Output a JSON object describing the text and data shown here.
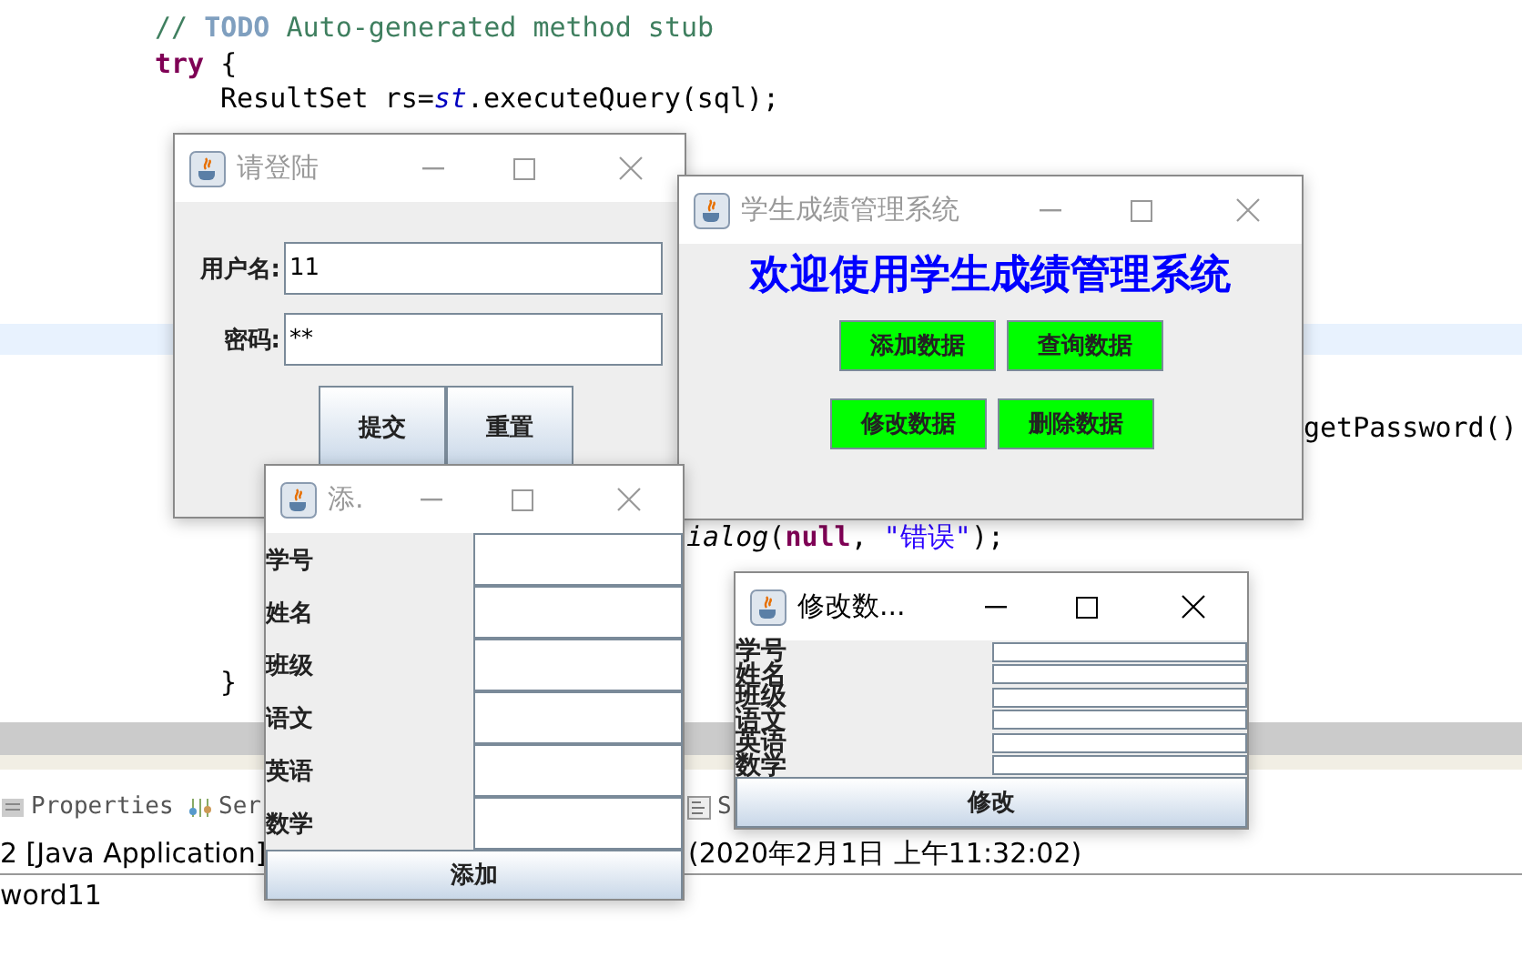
{
  "editor": {
    "code_lines": [
      [
        {
          "kind": "comment",
          "text": "// "
        },
        {
          "kind": "todo",
          "text": "TODO"
        },
        {
          "kind": "comment",
          "text": " Auto-generated method stub"
        }
      ],
      [
        {
          "kind": "keyword",
          "text": "try"
        },
        {
          "kind": "plain",
          "text": " {"
        }
      ],
      [
        {
          "kind": "plain",
          "text": "ResultSet rs="
        },
        {
          "kind": "field",
          "text": "st"
        },
        {
          "kind": "plain",
          "text": ".executeQuery(sql);"
        }
      ],
      [
        {
          "kind": "plain",
          "text": "getPassword()"
        }
      ],
      [
        {
          "kind": "method",
          "text": "ialog"
        },
        {
          "kind": "plain",
          "text": "("
        },
        {
          "kind": "keyword",
          "text": "null"
        },
        {
          "kind": "plain",
          "text": ", "
        },
        {
          "kind": "string",
          "text": "\"错误\""
        },
        {
          "kind": "plain",
          "text": ");"
        }
      ],
      [
        {
          "kind": "plain",
          "text": "}"
        }
      ]
    ]
  },
  "bottom_panel": {
    "tabs": [
      {
        "label": "Properties"
      },
      {
        "label": "Ser"
      },
      {
        "label": "S"
      }
    ],
    "console_title": "2 [Java Application]",
    "console_time": "(2020年2月1日 上午11:32:02)",
    "console_output": "word11"
  },
  "windows": [
    {
      "kind": "login",
      "title": "请登陆",
      "active": false,
      "fields": [
        {
          "label": "用户名:",
          "value": "11"
        },
        {
          "label": "密码:",
          "value": "**"
        }
      ],
      "buttons": [
        "提交",
        "重置"
      ]
    },
    {
      "kind": "menu",
      "title": "学生成绩管理系统",
      "active": false,
      "heading": "欢迎使用学生成绩管理系统",
      "buttons": [
        "添加数据",
        "查询数据",
        "修改数据",
        "删除数据"
      ]
    },
    {
      "kind": "form",
      "title": "添.",
      "active": false,
      "fields": [
        {
          "label": "学号"
        },
        {
          "label": "姓名"
        },
        {
          "label": "班级"
        },
        {
          "label": "语文"
        },
        {
          "label": "英语"
        },
        {
          "label": "数学"
        }
      ],
      "button": "添加"
    },
    {
      "kind": "compact_form",
      "title": "修改数...",
      "active": true,
      "fields": [
        {
          "label": "学号"
        },
        {
          "label": "姓名"
        },
        {
          "label": "班级"
        },
        {
          "label": "语文"
        },
        {
          "label": "英语"
        },
        {
          "label": "数学"
        }
      ],
      "button": "修改"
    }
  ]
}
